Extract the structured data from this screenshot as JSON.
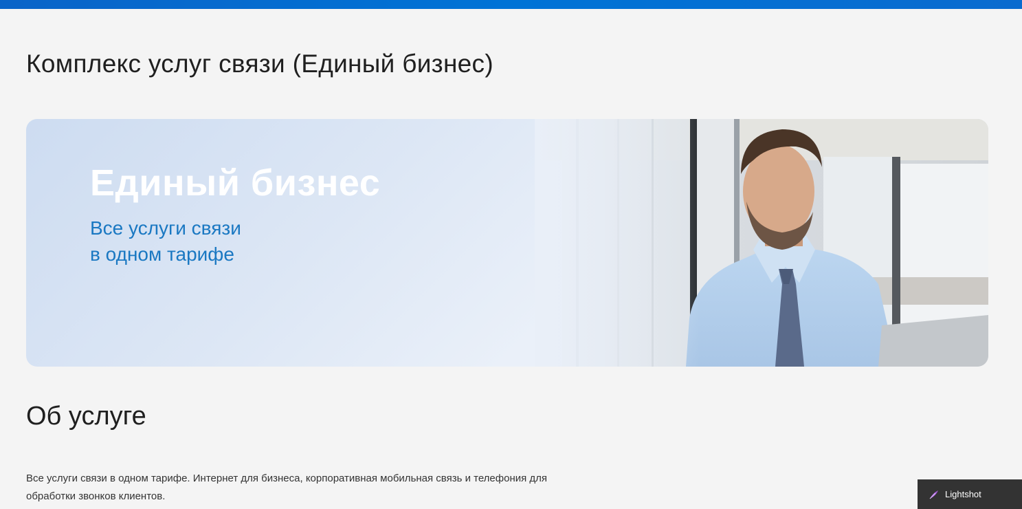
{
  "page": {
    "title": "Комплекс услуг связи (Единый бизнес)"
  },
  "banner": {
    "heading": "Единый бизнес",
    "subtitle_line1": "Все услуги связи",
    "subtitle_line2": "в одном тарифе"
  },
  "about": {
    "title": "Об услуге",
    "description": "Все услуги связи в одном тарифе. Интернет для бизнеса, корпоративная мобильная связь и телефония для обработки звонков клиентов."
  },
  "overlay": {
    "label": "Lightshot",
    "icon": "feather-icon"
  },
  "colors": {
    "accent": "#0073d6",
    "subtitle": "#1a78c2",
    "background": "#f4f4f4"
  }
}
